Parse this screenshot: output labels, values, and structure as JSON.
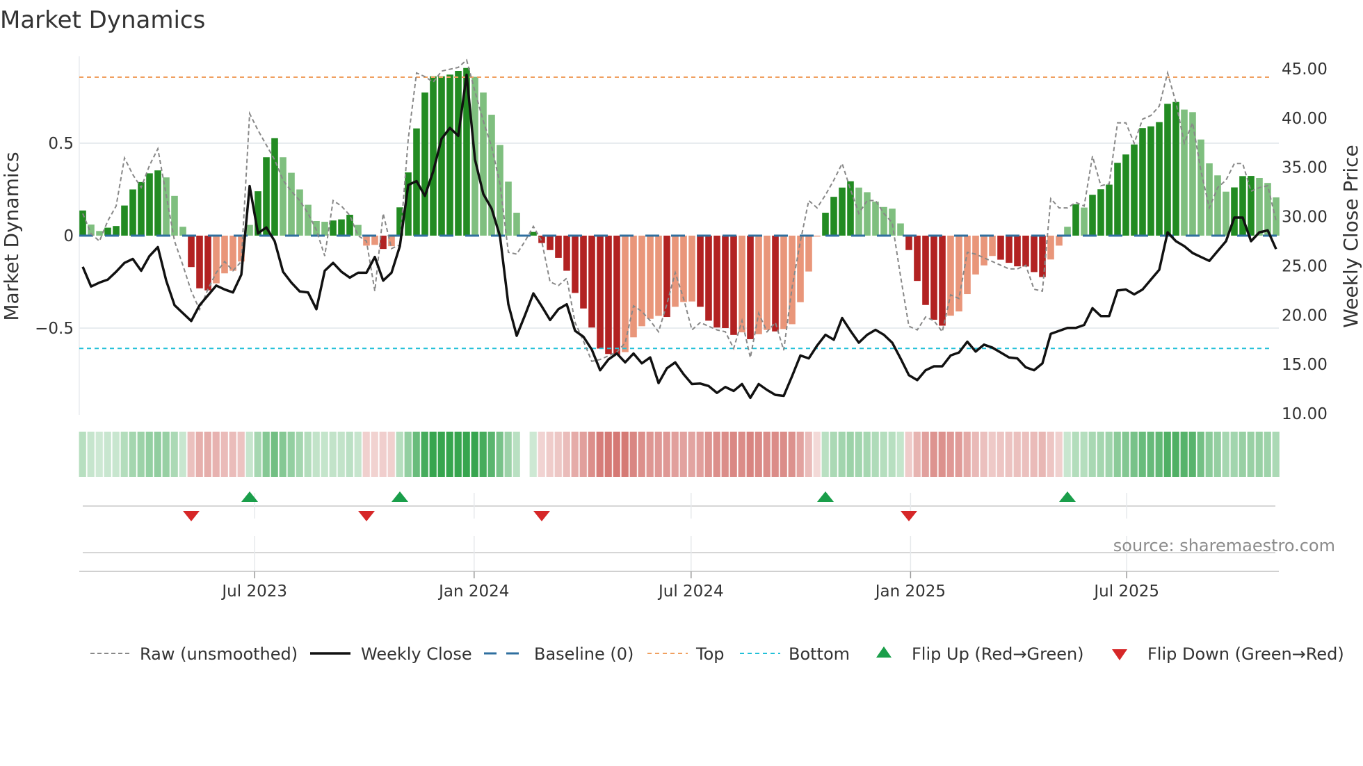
{
  "title": "Market Dynamics",
  "source": "source: sharemaestro.com",
  "colors": {
    "pos_strong": "#228b22",
    "pos_weak": "#7fbf7f",
    "neg_strong": "#b22222",
    "neg_weak": "#e9967a",
    "strip_pos": "44,160,70",
    "strip_neg": "200,80,74",
    "raw": "#888888",
    "close": "#111111",
    "baseline": "#2f6f9f",
    "top": "#f0a060",
    "bottom": "#22c0d8",
    "flip_up": "#1a9e4a",
    "flip_down": "#d62728",
    "grid": "#e8ecef"
  },
  "legend": [
    {
      "key": "raw",
      "label": "Raw (unsmoothed)"
    },
    {
      "key": "close",
      "label": "Weekly Close"
    },
    {
      "key": "baseline",
      "label": "Baseline (0)"
    },
    {
      "key": "top",
      "label": "Top"
    },
    {
      "key": "bottom",
      "label": "Bottom"
    },
    {
      "key": "flip_up",
      "label": "Flip Up (Red→Green)"
    },
    {
      "key": "flip_down",
      "label": "Flip Down (Green→Red)"
    }
  ],
  "chart_data": {
    "type": "bar",
    "title": "Market Dynamics",
    "ylabel": "Market Dynamics",
    "y2label": "Weekly Close Price",
    "ylim": [
      -0.97,
      0.97
    ],
    "y2lim": [
      9.86,
      46.27
    ],
    "yticks": [
      {
        "v": 0.5,
        "label": "0.5"
      },
      {
        "v": 0,
        "label": "0"
      },
      {
        "v": -0.5,
        "label": "−0.5"
      }
    ],
    "y2ticks": [
      {
        "v": 45,
        "label": "45.00"
      },
      {
        "v": 40,
        "label": "40.00"
      },
      {
        "v": 35,
        "label": "35.00"
      },
      {
        "v": 30,
        "label": "30.00"
      },
      {
        "v": 25,
        "label": "25.00"
      },
      {
        "v": 20,
        "label": "20.00"
      },
      {
        "v": 15,
        "label": "15.00"
      },
      {
        "v": 10,
        "label": "10.00"
      }
    ],
    "x_unit": "week index",
    "xticks": [
      {
        "v": 20.6,
        "label": "Jul 2023"
      },
      {
        "v": 46.9,
        "label": "Jan 2024"
      },
      {
        "v": 72.9,
        "label": "Jul 2024"
      },
      {
        "v": 99.2,
        "label": "Jan 2025"
      },
      {
        "v": 125.1,
        "label": "Jul 2025"
      }
    ],
    "top_level": 0.857,
    "bottom_level": -0.61,
    "baseline": 0,
    "dynamics": [
      0.136,
      0.06,
      0.025,
      0.043,
      0.052,
      0.163,
      0.25,
      0.29,
      0.337,
      0.353,
      0.315,
      0.215,
      0.048,
      -0.17,
      -0.285,
      -0.296,
      -0.258,
      -0.204,
      -0.19,
      -0.14,
      0.058,
      0.24,
      0.424,
      0.527,
      0.424,
      0.34,
      0.25,
      0.167,
      0.079,
      0.075,
      0.082,
      0.088,
      0.113,
      0.058,
      -0.054,
      -0.05,
      -0.072,
      -0.057,
      0.153,
      0.342,
      0.58,
      0.774,
      0.862,
      0.862,
      0.871,
      0.891,
      0.907,
      0.859,
      0.774,
      0.654,
      0.49,
      0.292,
      0.124,
      0,
      0.02,
      -0.04,
      -0.078,
      -0.12,
      -0.19,
      -0.31,
      -0.394,
      -0.497,
      -0.611,
      -0.64,
      -0.645,
      -0.63,
      -0.55,
      -0.49,
      -0.45,
      -0.434,
      -0.44,
      -0.385,
      -0.359,
      -0.356,
      -0.385,
      -0.46,
      -0.497,
      -0.5,
      -0.537,
      -0.523,
      -0.56,
      -0.533,
      -0.51,
      -0.518,
      -0.505,
      -0.479,
      -0.36,
      -0.194,
      -0.005,
      0.124,
      0.21,
      0.26,
      0.294,
      0.26,
      0.235,
      0.184,
      0.155,
      0.146,
      0.066,
      -0.078,
      -0.245,
      -0.375,
      -0.455,
      -0.487,
      -0.433,
      -0.41,
      -0.316,
      -0.21,
      -0.161,
      -0.11,
      -0.13,
      -0.147,
      -0.166,
      -0.167,
      -0.197,
      -0.224,
      -0.129,
      -0.054,
      0.048,
      0.17,
      0.152,
      0.221,
      0.251,
      0.276,
      0.394,
      0.439,
      0.493,
      0.582,
      0.591,
      0.614,
      0.713,
      0.723,
      0.682,
      0.668,
      0.52,
      0.391,
      0.326,
      0.238,
      0.261,
      0.322,
      0.323,
      0.312,
      0.285,
      0.207
    ],
    "raw": [
      0.12,
      0.01,
      -0.03,
      0.08,
      0.16,
      0.42,
      0.33,
      0.26,
      0.38,
      0.47,
      0.22,
      -0.03,
      -0.16,
      -0.3,
      -0.4,
      -0.29,
      -0.2,
      -0.14,
      -0.19,
      -0.14,
      0.66,
      0.57,
      0.49,
      0.41,
      0.3,
      0.24,
      0.19,
      0.12,
      0.03,
      -0.11,
      0.19,
      0.16,
      0.11,
      0,
      -0.03,
      -0.3,
      0.12,
      -0.07,
      -0.05,
      0.52,
      0.88,
      0.86,
      0.83,
      0.89,
      0.9,
      0.91,
      0.95,
      0.78,
      0.62,
      0.48,
      0.28,
      -0.09,
      -0.1,
      -0.03,
      0.05,
      -0.03,
      -0.25,
      -0.27,
      -0.23,
      -0.47,
      -0.57,
      -0.68,
      -0.67,
      -0.65,
      -0.63,
      -0.58,
      -0.38,
      -0.41,
      -0.46,
      -0.52,
      -0.37,
      -0.2,
      -0.34,
      -0.51,
      -0.47,
      -0.49,
      -0.51,
      -0.52,
      -0.61,
      -0.46,
      -0.66,
      -0.42,
      -0.52,
      -0.47,
      -0.62,
      -0.28,
      -0.03,
      0.19,
      0.15,
      0.22,
      0.3,
      0.39,
      0.25,
      0.12,
      0.19,
      0.19,
      0.12,
      0.07,
      -0.22,
      -0.49,
      -0.51,
      -0.44,
      -0.46,
      -0.52,
      -0.32,
      -0.34,
      -0.09,
      -0.1,
      -0.12,
      -0.14,
      -0.16,
      -0.18,
      -0.18,
      -0.16,
      -0.29,
      -0.3,
      0.2,
      0.15,
      0.15,
      0.18,
      0.16,
      0.43,
      0.27,
      0.28,
      0.61,
      0.61,
      0.5,
      0.63,
      0.65,
      0.7,
      0.88,
      0.72,
      0.5,
      0.61,
      0.35,
      0.15,
      0.26,
      0.3,
      0.39,
      0.39,
      0.24,
      0.26,
      0.27,
      0.08
    ],
    "close": [
      24.9,
      22.9,
      23.3,
      23.6,
      24.4,
      25.3,
      25.7,
      24.5,
      26.0,
      26.9,
      23.5,
      21.0,
      20.2,
      19.4,
      21.0,
      22.0,
      23.0,
      22.6,
      22.3,
      24.1,
      33.1,
      28.3,
      28.9,
      27.5,
      24.4,
      23.3,
      22.4,
      22.3,
      20.6,
      24.5,
      25.3,
      24.4,
      23.8,
      24.3,
      24.3,
      25.9,
      23.5,
      24.3,
      27.0,
      33.2,
      33.6,
      32.1,
      34.6,
      37.9,
      39.0,
      38.2,
      44.4,
      35.8,
      32.3,
      30.8,
      28.0,
      21.1,
      17.9,
      20.0,
      22.2,
      20.9,
      19.5,
      20.6,
      21.1,
      18.4,
      17.8,
      16.5,
      14.4,
      15.5,
      16.1,
      15.2,
      16.1,
      15.1,
      15.7,
      13.1,
      14.6,
      15.2,
      14.0,
      13.0,
      13.05,
      12.8,
      12.1,
      12.7,
      12.3,
      13.0,
      11.6,
      13.0,
      12.4,
      11.9,
      11.8,
      13.8,
      15.9,
      15.6,
      16.9,
      18.0,
      17.5,
      19.7,
      18.4,
      17.2,
      18.0,
      18.5,
      18.0,
      17.2,
      15.6,
      13.9,
      13.4,
      14.4,
      14.8,
      14.8,
      15.9,
      16.2,
      17.3,
      16.3,
      17.0,
      16.7,
      16.2,
      15.7,
      15.6,
      14.7,
      14.4,
      15.1,
      18.1,
      18.4,
      18.7,
      18.7,
      19.0,
      20.7,
      19.9,
      19.9,
      22.5,
      22.6,
      22.1,
      22.6,
      23.6,
      24.6,
      28.4,
      27.5,
      27.0,
      26.3,
      25.9,
      25.5,
      26.5,
      27.5,
      29.9,
      29.9,
      27.5,
      28.4,
      28.6,
      26.7
    ],
    "flips_up": [
      20,
      38,
      89,
      118
    ],
    "flips_down": [
      13,
      34,
      55,
      99
    ],
    "legend_position": "bottom"
  }
}
